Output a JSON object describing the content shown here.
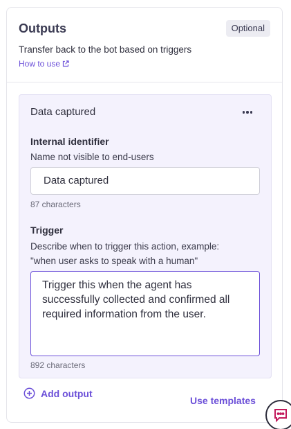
{
  "outputs": {
    "title": "Outputs",
    "badge": "Optional",
    "subtitle": "Transfer back to the bot based on triggers",
    "how_to_use": "How to use"
  },
  "card": {
    "title": "Data captured",
    "menu_icon": "more-horizontal-icon",
    "internal_identifier": {
      "label": "Internal identifier",
      "description": "Name not visible to end-users",
      "value": "Data captured",
      "count": "87 characters"
    },
    "trigger": {
      "label": "Trigger",
      "description_line1": "Describe when to trigger this action, example:",
      "description_line2": "\"when user asks to speak with a human\"",
      "value": "Trigger this when the agent has successfully collected and confirmed all required information from the user.",
      "count": "892 characters"
    }
  },
  "footer": {
    "add_output": "Add output",
    "use_templates": "Use templates"
  },
  "colors": {
    "accent": "#6b4fd8",
    "card_bg": "#f4f2fd"
  }
}
